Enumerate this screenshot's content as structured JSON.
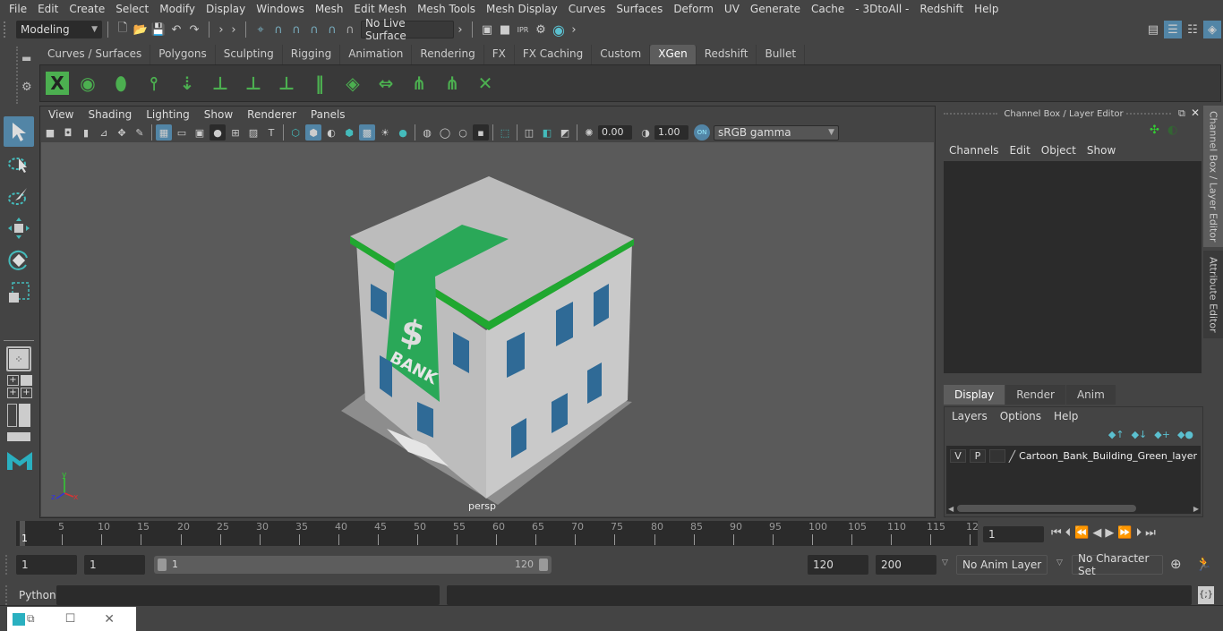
{
  "menubar": {
    "items": [
      "File",
      "Edit",
      "Create",
      "Select",
      "Modify",
      "Display",
      "Windows",
      "Mesh",
      "Edit Mesh",
      "Mesh Tools",
      "Mesh Display",
      "Curves",
      "Surfaces",
      "Deform",
      "UV",
      "Generate",
      "Cache",
      "- 3DtoAll -",
      "Redshift",
      "Help"
    ]
  },
  "statusline": {
    "mode": "Modeling",
    "live_surface": "No Live Surface"
  },
  "shelf": {
    "tabs": [
      "Curves / Surfaces",
      "Polygons",
      "Sculpting",
      "Rigging",
      "Animation",
      "Rendering",
      "FX",
      "FX Caching",
      "Custom",
      "XGen",
      "Redshift",
      "Bullet"
    ],
    "active_tab": "XGen",
    "icons": [
      "xgen-editor-icon",
      "xgen-preview-icon",
      "xgen-clear-preview-icon",
      "add-guides-icon",
      "place-guides-icon",
      "add-guide-icon",
      "toggle-guide-visibility-icon",
      "lock-guides-icon",
      "guide-split-icon",
      "create-description-icon",
      "guide-transfer-icon",
      "select-guides-icon",
      "guide-region-icon",
      "delete-guides-icon"
    ]
  },
  "viewport": {
    "menus": [
      "View",
      "Shading",
      "Lighting",
      "Show",
      "Renderer",
      "Panels"
    ],
    "exposure": "0.00",
    "gamma": "1.00",
    "color_mgmt": "ON",
    "colorspace": "sRGB gamma",
    "camera_label": "persp",
    "axis": {
      "x": "x",
      "y": "y",
      "z": "z"
    },
    "model_sign": {
      "symbol": "$",
      "text": "BANK"
    }
  },
  "channel_box": {
    "title": "Channel Box / Layer Editor",
    "menus": [
      "Channels",
      "Edit",
      "Object",
      "Show"
    ],
    "side_tabs": [
      "Channel Box / Layer Editor",
      "Attribute Editor"
    ]
  },
  "layer_editor": {
    "tabs": [
      "Display",
      "Render",
      "Anim"
    ],
    "active_tab": "Display",
    "menus": [
      "Layers",
      "Options",
      "Help"
    ],
    "layers": [
      {
        "visible": "V",
        "playback": "P",
        "type": "",
        "name": "Cartoon_Bank_Building_Green_layer"
      }
    ]
  },
  "timeline": {
    "ticks": [
      "5",
      "10",
      "15",
      "20",
      "25",
      "30",
      "35",
      "40",
      "45",
      "50",
      "55",
      "60",
      "65",
      "70",
      "75",
      "80",
      "85",
      "90",
      "95",
      "100",
      "105",
      "110",
      "115",
      "12"
    ],
    "current_frame_marker": "1",
    "current_frame": "1"
  },
  "range": {
    "start": "1",
    "playback_start": "1",
    "slider_start": "1",
    "slider_end": "120",
    "playback_end": "120",
    "end": "200",
    "anim_layer": "No Anim Layer",
    "character_set": "No Character Set"
  },
  "command_line": {
    "language": "Python",
    "input": "",
    "output": ""
  },
  "colors": {
    "accent": "#5285a6",
    "xgen_green": "#4caf50",
    "bank_green": "#22a833",
    "window_blue": "#2f6a96",
    "viewport_bg": "#5a5a5a",
    "key_orange": "#e07a30"
  }
}
